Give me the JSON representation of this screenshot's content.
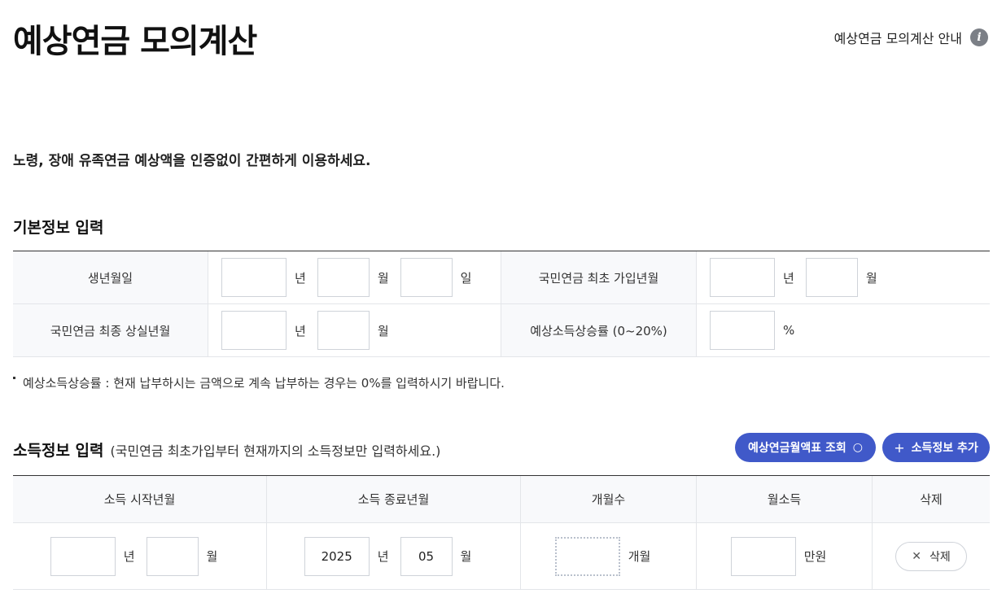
{
  "header": {
    "title": "예상연금 모의계산",
    "guide_link": "예상연금 모의계산 안내",
    "info_icon": "i"
  },
  "intro": "노령, 장애 유족연금 예상액을 인증없이 간편하게 이용하세요.",
  "basic": {
    "title": "기본정보 입력",
    "birth_label": "생년월일",
    "first_join_label": "국민연금 최초 가입년월",
    "last_loss_label": "국민연금 최종 상실년월",
    "growth_label": "예상소득상승률 (0~20%)",
    "unit_year": "년",
    "unit_month": "월",
    "unit_day": "일",
    "unit_percent": "%",
    "note": "예상소득상승률 : 현재 납부하시는 금액으로 계속 납부하는 경우는 0%를 입력하시기 바랍니다."
  },
  "income": {
    "title": "소득정보 입력",
    "subtitle": "(국민연금 최초가입부터 현재까지의 소득정보만 입력하세요.)",
    "lookup_button": "예상연금월액표 조회",
    "add_button": "소득정보 추가",
    "add_icon": "+",
    "search_icon": "○",
    "headers": [
      "소득 시작년월",
      "소득 종료년월",
      "개월수",
      "월소득",
      "삭제"
    ],
    "row": {
      "end_year": "2025",
      "end_month": "05",
      "unit_year": "년",
      "unit_month": "월",
      "unit_months": "개월",
      "unit_money": "만원",
      "delete_label": "삭제",
      "delete_icon": "✕"
    }
  }
}
